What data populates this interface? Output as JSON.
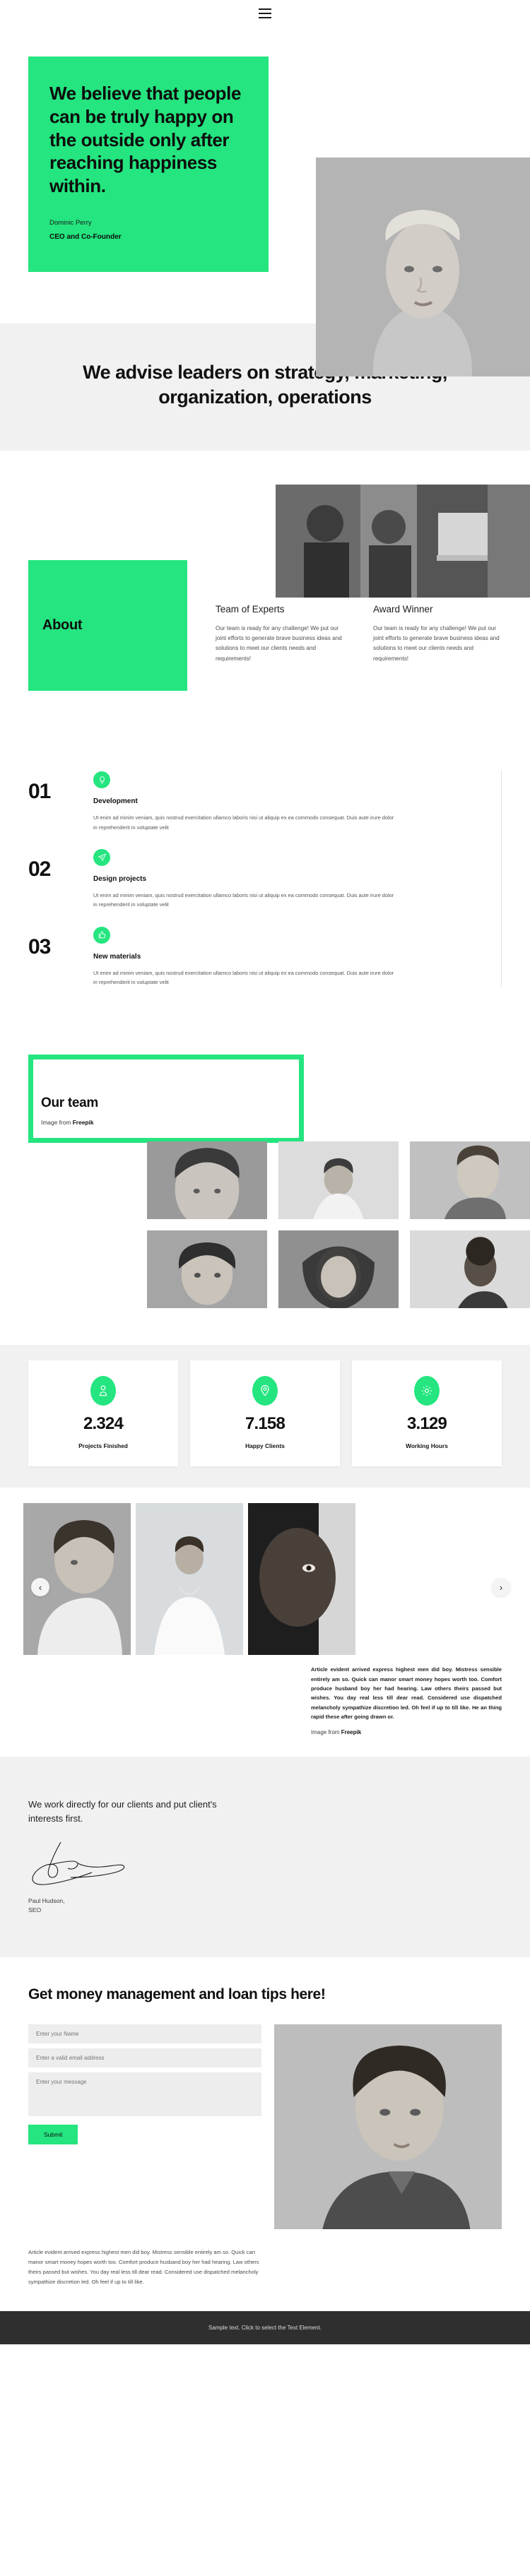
{
  "nav": {
    "menu_icon": "hamburger-menu-icon"
  },
  "hero": {
    "quote": "We believe that people can be truly happy on the outside only after reaching happiness within.",
    "author": "Dominic Perry",
    "role": "CEO and Co-Founder",
    "photo_alt": "portrait-woman-blonde"
  },
  "banner": {
    "heading": "We advise leaders on strategy, marketing, organization, operations"
  },
  "about": {
    "photo_alt": "office-meeting-photo",
    "title": "About",
    "columns": [
      {
        "title": "Team of Experts",
        "text": "Our team is ready for any challenge! We put our joint efforts to generate brave business ideas and solutions to meet our clients needs and requirements!"
      },
      {
        "title": "Award Winner",
        "text": "Our team is ready for any challenge! We put our joint efforts to generate brave business ideas and solutions to meet our clients needs and requirements!"
      }
    ]
  },
  "steps": [
    {
      "number": "01",
      "icon": "lightbulb-icon",
      "title": "Development",
      "text": "Ut enim ad minim veniam, quis nostrud exercitation ullamco laboris nisi ut aliquip ex ea commodo consequat. Duis aute irure dolor in reprehenderit in voluptate velit"
    },
    {
      "number": "02",
      "icon": "paper-plane-icon",
      "title": "Design projects",
      "text": "Ut enim ad minim veniam, quis nostrud exercitation ullamco laboris nisi ut aliquip ex ea commodo consequat. Duis aute irure dolor in reprehenderit in voluptate velit"
    },
    {
      "number": "03",
      "icon": "thumbs-up-icon",
      "title": "New materials",
      "text": "Ut enim ad minim veniam, quis nostrud exercitation ullamco laboris nisi ut aliquip ex ea commodo consequat. Duis aute irure dolor in reprehenderit in voluptate velit"
    }
  ],
  "team": {
    "title": "Our team",
    "credit_prefix": "Image from ",
    "credit_source": "Freepik",
    "photos": [
      "team-photo-1",
      "team-photo-2",
      "team-photo-3",
      "team-photo-4",
      "team-photo-5",
      "team-photo-6"
    ]
  },
  "stats": [
    {
      "icon": "person-icon",
      "value": "2.324",
      "label": "Projects Finished"
    },
    {
      "icon": "location-pin-icon",
      "value": "7.158",
      "label": "Happy Clients"
    },
    {
      "icon": "gear-icon",
      "value": "3.129",
      "label": "Working Hours"
    }
  ],
  "carousel": {
    "prev_label": "‹",
    "next_label": "›",
    "slides": [
      "carousel-photo-1",
      "carousel-photo-2",
      "carousel-photo-3"
    ],
    "text": "Article evident arrived express highest men did boy. Mistress sensible entirely am so. Quick can manor smart money hopes worth too. Comfort produce husband boy her had hearing. Law others theirs passed but wishes. You day real less till dear read. Considered use dispatched melancholy sympathize discretion led. Oh feel if up to till like. He an thing rapid these after going drawn or.",
    "credit_prefix": "Image from ",
    "credit_source": "Freepik"
  },
  "signature": {
    "heading": "We work directly for our clients and put client's interests first.",
    "name": "Paul Hudson,\nSEO"
  },
  "contact": {
    "heading": "Get money management and loan tips here!",
    "name_placeholder": "Enter your Name",
    "email_placeholder": "Enter a valid email address",
    "message_placeholder": "Enter your message",
    "submit_label": "Submit",
    "photo_alt": "portrait-woman-jacket",
    "footer_text": "Article evident arrived express highest men did boy. Mistress sensible entirely am so. Quick can manor smart money hopes worth too. Comfort produce husband boy her had hearing. Law others theirs passed but wishes. You day real less till dear read. Considered use dispatched melancholy sympathize discretion led. Oh feel if up to till like."
  },
  "footer": {
    "text": "Sample text. Click to select the Text Element."
  },
  "colors": {
    "accent_green": "#24e57f",
    "banner_bg": "#f1f1f1",
    "footer_bg": "#2f2f2f",
    "text_dark": "#111111"
  }
}
